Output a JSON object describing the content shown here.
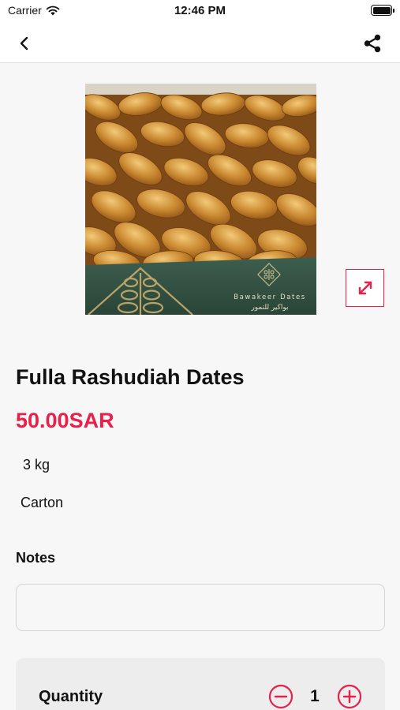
{
  "status_bar": {
    "carrier": "Carrier",
    "time": "12:46 PM"
  },
  "nav": {
    "back_icon": "chevron-left-icon",
    "share_icon": "share-icon"
  },
  "product": {
    "image_brand_text": "Bawakeer Dates",
    "image_brand_text_ar": "بواكير للتمور",
    "title": "Fulla Rashudiah Dates",
    "price": "50.00SAR",
    "weight": "3 kg",
    "package": "Carton"
  },
  "notes": {
    "label": "Notes",
    "value": "",
    "placeholder": ""
  },
  "quantity": {
    "label": "Quantity",
    "value": "1"
  },
  "colors": {
    "accent": "#e8204a",
    "background": "#f7f7f7"
  }
}
